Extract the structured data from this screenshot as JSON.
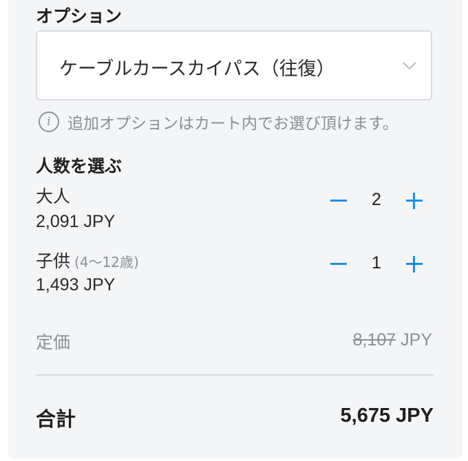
{
  "options": {
    "title": "オプション",
    "selected": "ケーブルカースカイパス（往復）",
    "chevron_icon": "chevron-down-icon",
    "info_icon": "info-icon",
    "info_text": "追加オプションはカート内でお選び頂けます。"
  },
  "people": {
    "title": "人数を選ぶ",
    "tickets": [
      {
        "name": "大人",
        "sub": "",
        "price": "2,091 JPY",
        "count": "2"
      },
      {
        "name": "子供",
        "sub": "(4〜12歳)",
        "price": "1,493 JPY",
        "count": "1"
      }
    ]
  },
  "summary": {
    "list_price_label": "定価",
    "list_price_amount": "8,107",
    "list_price_currency": "JPY",
    "total_label": "合計",
    "total_value": "5,675 JPY"
  },
  "colors": {
    "accent": "#1a8fe8",
    "panel_bg": "#f4f5f7",
    "muted_text": "#8a8f96"
  }
}
